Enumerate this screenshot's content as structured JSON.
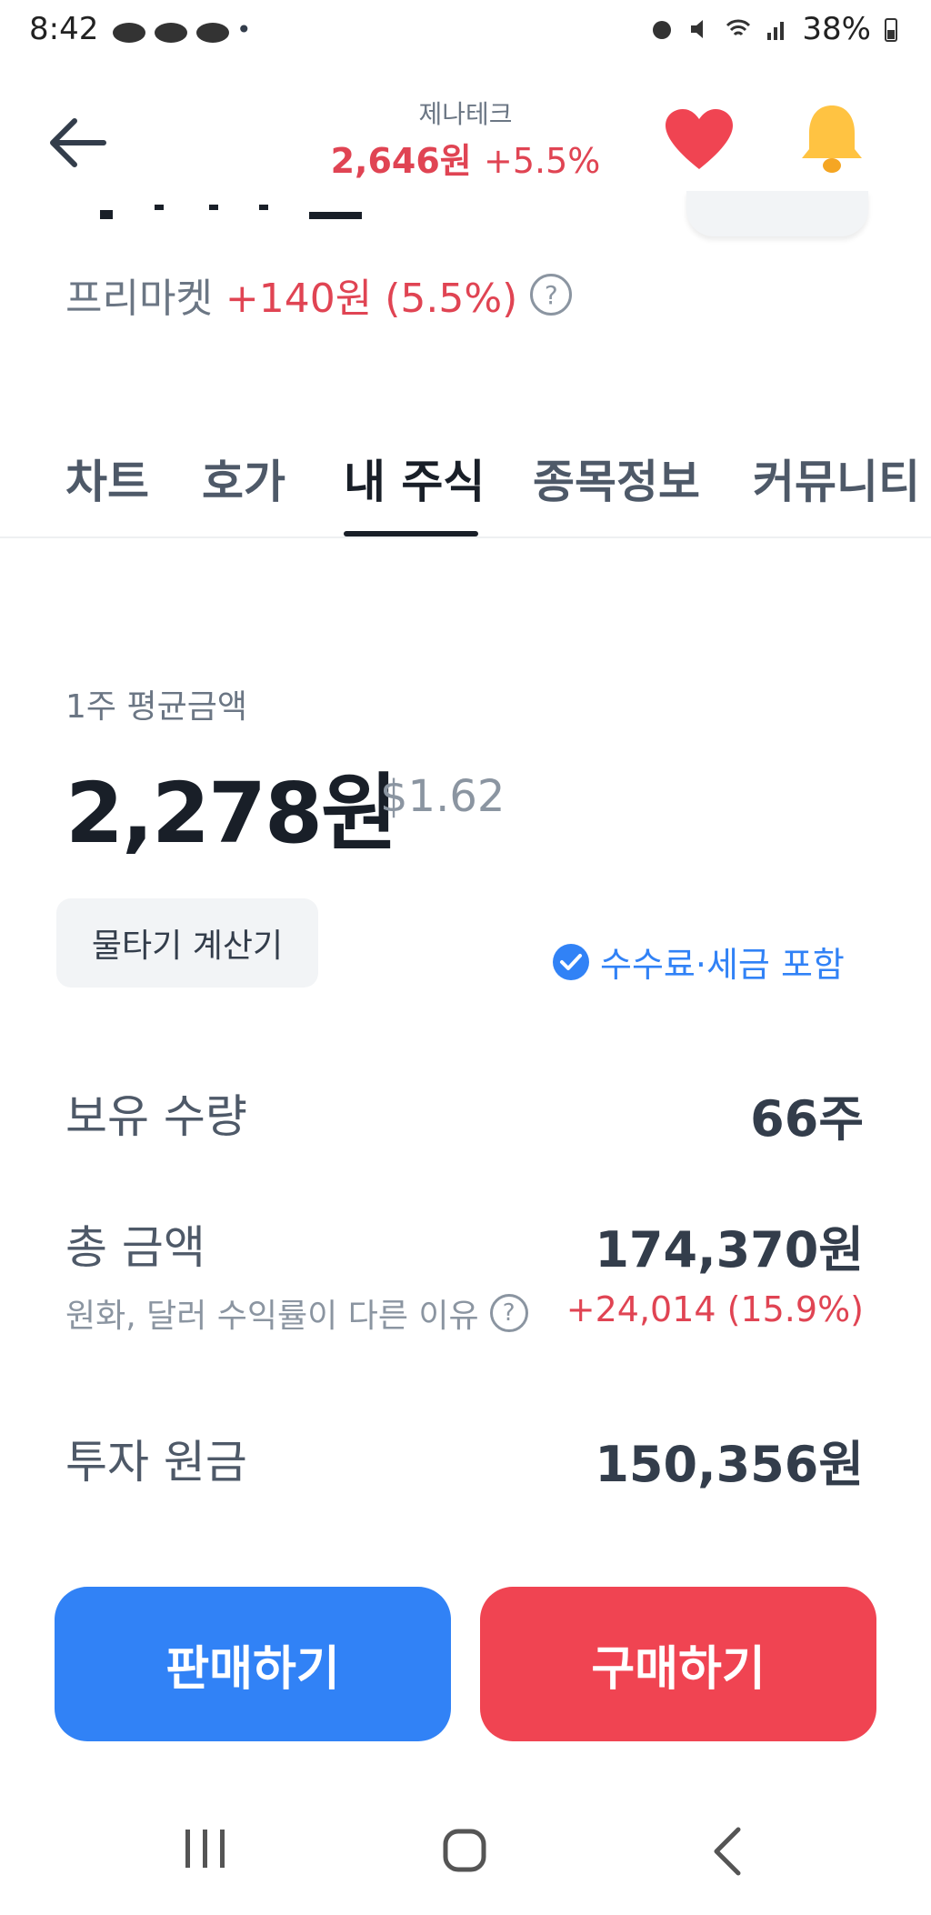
{
  "status_bar": {
    "time": "8:42",
    "dot": "•",
    "battery": "38%",
    "icons": [
      "cloud-icon",
      "cloud-icon",
      "cloud-icon",
      "dot",
      "alarm-icon",
      "mute-icon",
      "wifi-icon",
      "signal-icon",
      "battery-icon"
    ]
  },
  "header": {
    "stock_name": "제나테크",
    "price": "2,646원",
    "change": "+5.5%",
    "back_icon": "arrow-left-icon",
    "favorite_icon": "heart-icon",
    "alert_icon": "bell-icon"
  },
  "premarket": {
    "label": "프리마켓",
    "change": "+140원 (5.5%)",
    "help_icon": "?"
  },
  "tabs": [
    {
      "label": "차트"
    },
    {
      "label": "호가"
    },
    {
      "label": "내 주식",
      "active": true
    },
    {
      "label": "종목정보"
    },
    {
      "label": "커뮤니티"
    }
  ],
  "my_stock": {
    "avg_label": "1주 평균금액",
    "avg_price": "2,278원",
    "avg_usd": "$1.62",
    "calc_button": "물타기 계산기",
    "fee_toggle": "수수료·세금 포함",
    "quantity_label": "보유 수량",
    "quantity_value": "66주",
    "total_label": "총 금액",
    "total_value": "174,370원",
    "diff_reason": "원화, 달러 수익률이 다른 이유",
    "help_icon": "?",
    "profit": "+24,014 (15.9%)",
    "principal_label": "투자 원금",
    "principal_value": "150,356원"
  },
  "actions": {
    "sell": "판매하기",
    "buy": "구매하기"
  },
  "colors": {
    "red": "#f04452",
    "blue": "#3182f6",
    "text_dark": "#191f28",
    "text_gray": "#6b7684"
  }
}
